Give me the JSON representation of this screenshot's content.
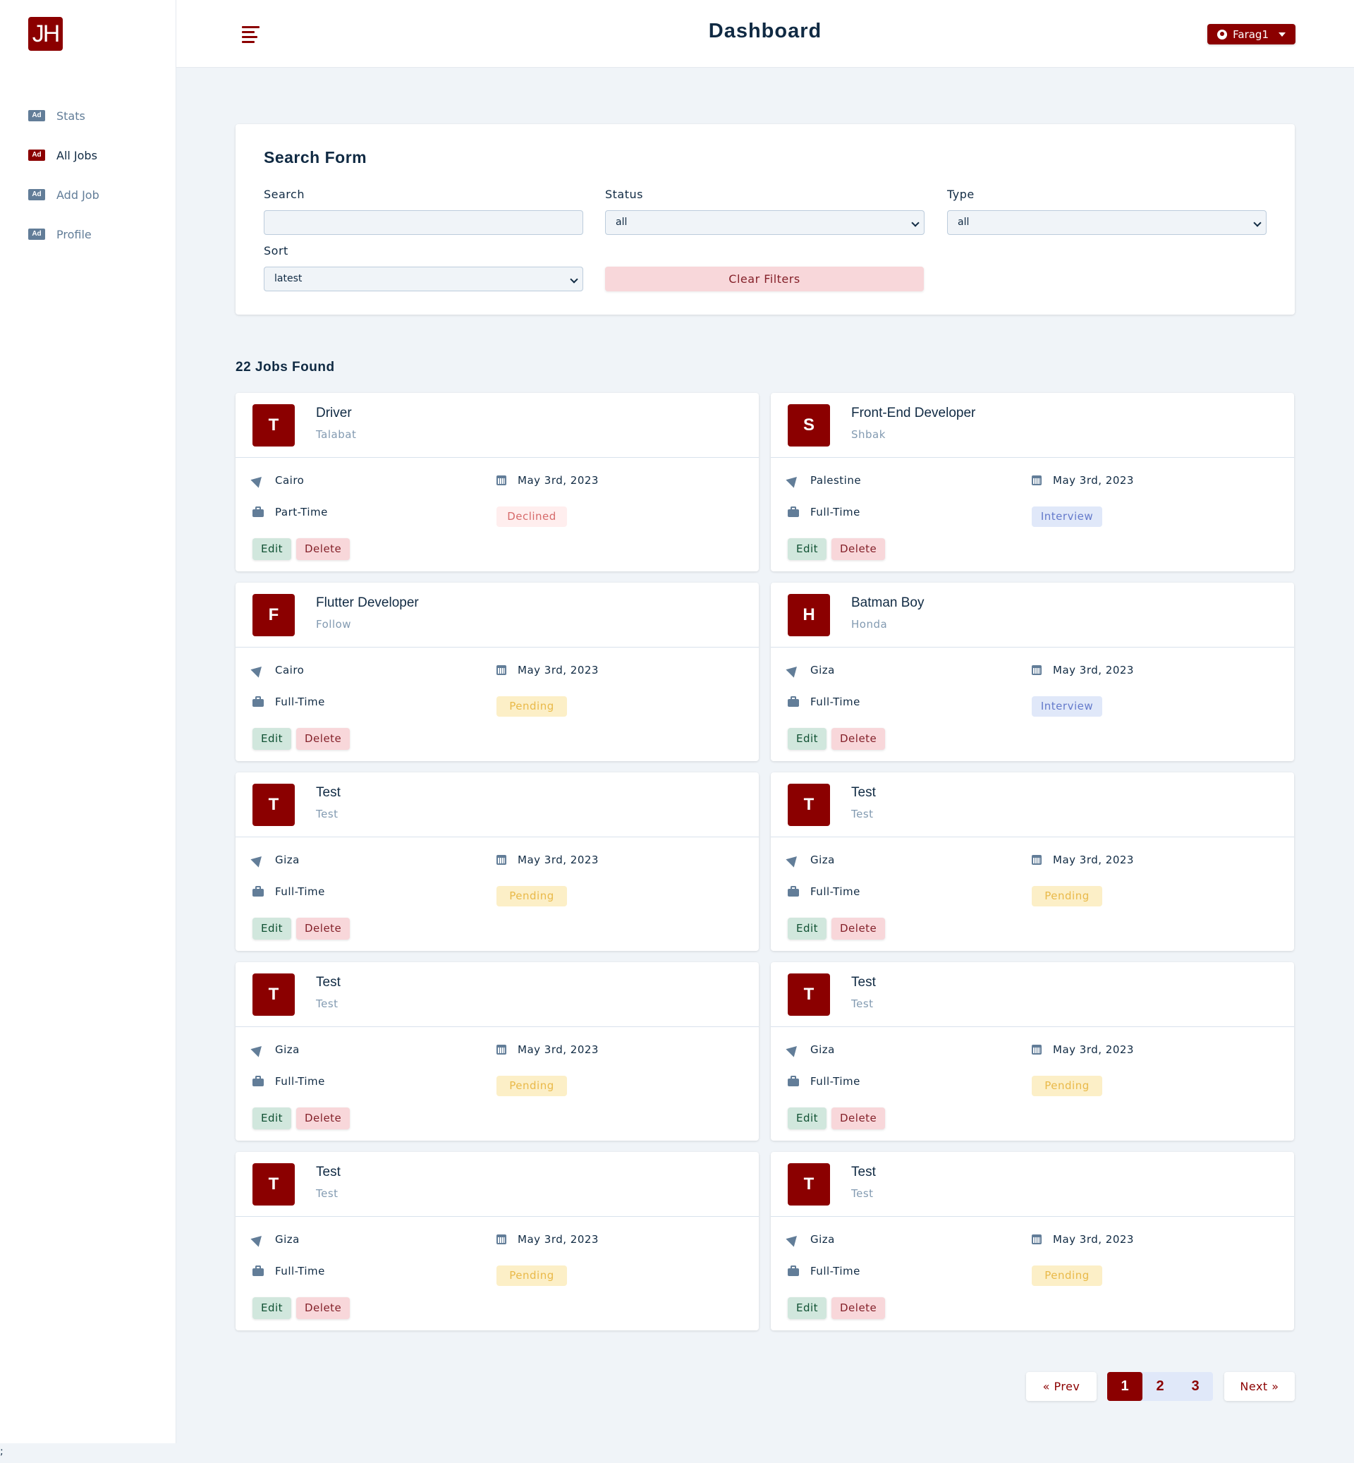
{
  "app": {
    "logo_text": "JH",
    "page_title": "Dashboard",
    "user_name": "Farag1"
  },
  "sidebar": {
    "items": [
      {
        "label": "Stats",
        "icon": "Ad"
      },
      {
        "label": "All Jobs",
        "icon": "Ad"
      },
      {
        "label": "Add Job",
        "icon": "Ad"
      },
      {
        "label": "Profile",
        "icon": "Ad"
      }
    ]
  },
  "search_form": {
    "title": "Search Form",
    "search_label": "Search",
    "search_value": "",
    "status_label": "Status",
    "status_value": "all",
    "type_label": "Type",
    "type_value": "all",
    "sort_label": "Sort",
    "sort_value": "latest",
    "clear_label": "Clear Filters"
  },
  "jobs_found": "22 Jobs Found",
  "job_actions": {
    "edit": "Edit",
    "delete": "Delete"
  },
  "jobs": [
    {
      "initial": "T",
      "position": "Driver",
      "company": "Talabat",
      "location": "Cairo",
      "date": "May 3rd, 2023",
      "type": "Part-Time",
      "status": "Declined",
      "status_key": "declined"
    },
    {
      "initial": "S",
      "position": "Front-End Developer",
      "company": "Shbak",
      "location": "Palestine",
      "date": "May 3rd, 2023",
      "type": "Full-Time",
      "status": "Interview",
      "status_key": "interview"
    },
    {
      "initial": "F",
      "position": "Flutter Developer",
      "company": "Follow",
      "location": "Cairo",
      "date": "May 3rd, 2023",
      "type": "Full-Time",
      "status": "Pending",
      "status_key": "pending"
    },
    {
      "initial": "H",
      "position": "Batman Boy",
      "company": "Honda",
      "location": "Giza",
      "date": "May 3rd, 2023",
      "type": "Full-Time",
      "status": "Interview",
      "status_key": "interview"
    },
    {
      "initial": "T",
      "position": "Test",
      "company": "Test",
      "location": "Giza",
      "date": "May 3rd, 2023",
      "type": "Full-Time",
      "status": "Pending",
      "status_key": "pending"
    },
    {
      "initial": "T",
      "position": "Test",
      "company": "Test",
      "location": "Giza",
      "date": "May 3rd, 2023",
      "type": "Full-Time",
      "status": "Pending",
      "status_key": "pending"
    },
    {
      "initial": "T",
      "position": "Test",
      "company": "Test",
      "location": "Giza",
      "date": "May 3rd, 2023",
      "type": "Full-Time",
      "status": "Pending",
      "status_key": "pending"
    },
    {
      "initial": "T",
      "position": "Test",
      "company": "Test",
      "location": "Giza",
      "date": "May 3rd, 2023",
      "type": "Full-Time",
      "status": "Pending",
      "status_key": "pending"
    },
    {
      "initial": "T",
      "position": "Test",
      "company": "Test",
      "location": "Giza",
      "date": "May 3rd, 2023",
      "type": "Full-Time",
      "status": "Pending",
      "status_key": "pending"
    },
    {
      "initial": "T",
      "position": "Test",
      "company": "Test",
      "location": "Giza",
      "date": "May 3rd, 2023",
      "type": "Full-Time",
      "status": "Pending",
      "status_key": "pending"
    }
  ],
  "pagination": {
    "prev": "« Prev",
    "next": "Next »",
    "pages": [
      "1",
      "2",
      "3"
    ],
    "current": "1"
  },
  "footer_text": ";",
  "colors": {
    "brand": "#8b0000",
    "background": "#f0f4f8"
  }
}
